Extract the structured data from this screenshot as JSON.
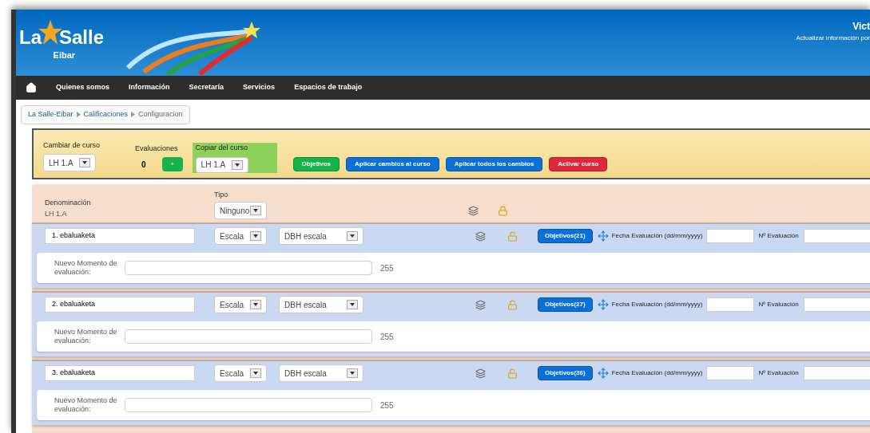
{
  "header": {
    "logo": {
      "word_left": "La",
      "word_right": "Salle",
      "subtitle": "Eibar"
    },
    "user_name": "Vict",
    "user_link": "Actualizar información por"
  },
  "nav": {
    "items": [
      "Quienes somos",
      "Información",
      "Secretaría",
      "Servicios",
      "Espacios de trabajo"
    ]
  },
  "breadcrumb": [
    "La Salle-Eibar",
    "Calificaciones",
    "Configuracion"
  ],
  "toolbar": {
    "change_course_label": "Cambiar de curso",
    "change_course_value": "LH 1.A",
    "evaluations_label": "Evaluaciones",
    "evaluations_count": "0",
    "add_button": "+",
    "copy_course_label": "Copiar del curso",
    "copy_course_value": "LH 1.A",
    "buttons": [
      {
        "label": "Objetivos",
        "kind": "green"
      },
      {
        "label": "Aplicar cambios al curso",
        "kind": "blue"
      },
      {
        "label": "Aplicar todos los cambios",
        "kind": "blue"
      },
      {
        "label": "Activar curso",
        "kind": "red"
      }
    ]
  },
  "table_header": {
    "name_label": "Denominación",
    "course": "LH 1.A",
    "type_label": "Tipo",
    "type_value": "Ninguno",
    "locked": true
  },
  "rows": [
    {
      "name": "1. ebaluaketa",
      "type": "Escala",
      "scale": "DBH escala",
      "locked": false,
      "objectives_button": "Objetivos(21)",
      "date_label": "Fecha Evaluación (dd/mm/yyyy)",
      "number_label": "Nº Evaluación",
      "moment_label": "Nuevo Momento de evaluación:",
      "max_length": "255"
    },
    {
      "name": "2. ebaluaketa",
      "type": "Escala",
      "scale": "DBH escala",
      "locked": false,
      "objectives_button": "Objetivos(27)",
      "date_label": "Fecha Evaluación (dd/mm/yyyy)",
      "number_label": "Nº Evaluación",
      "moment_label": "Nuevo Momento de evaluación:",
      "max_length": "255"
    },
    {
      "name": "3. ebaluaketa",
      "type": "Escala",
      "scale": "DBH escala",
      "locked": false,
      "objectives_button": "Objetivos(36)",
      "date_label": "Fecha Evaluación (dd/mm/yyyy)",
      "number_label": "Nº Evaluación",
      "moment_label": "Nuevo Momento de evaluación:",
      "max_length": "255"
    }
  ]
}
